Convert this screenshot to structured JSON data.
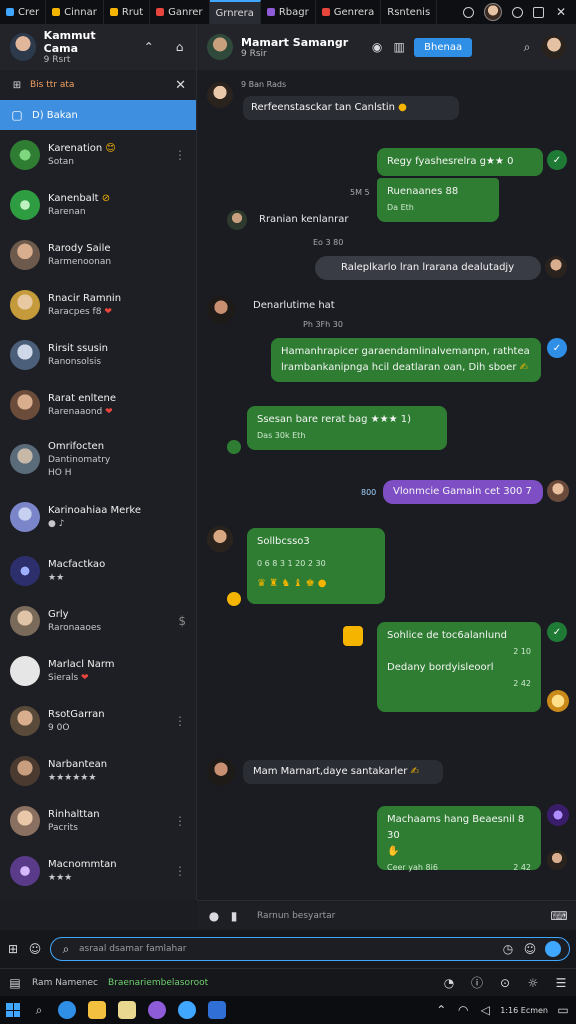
{
  "tabs": [
    {
      "label": "Crer",
      "color": "#3fa7ff"
    },
    {
      "label": "Cinnar",
      "color": "#f4b400"
    },
    {
      "label": "Rrut",
      "color": "#f4b400"
    },
    {
      "label": "Ganrer",
      "color": "#e8453c"
    },
    {
      "label": "Grnrera",
      "color": "#3fa7ff",
      "active": true
    },
    {
      "label": "Rbagr",
      "color": "#8e5cd9"
    },
    {
      "label": "Genrera",
      "color": "#e8453c"
    },
    {
      "label": "Rsntenis",
      "color": "#888888"
    }
  ],
  "sidebar": {
    "profile": {
      "name": "Kammut Cama",
      "sub": "9 Rsrt"
    },
    "search_text": "Bis ttr ata",
    "selected_label": "D) Bakan",
    "items": [
      {
        "name": "Karenation",
        "preview": "Sotan",
        "color": "#2e7d32",
        "badge": "😊"
      },
      {
        "name": "Kanenbalt",
        "preview": "Rarenan",
        "color": "#2e9d42",
        "badge": "⊘"
      },
      {
        "name": "Rarody Saile",
        "preview": "Rarmenoonan",
        "color": "#6d5a4c"
      },
      {
        "name": "Rnacir Ramnin",
        "preview": "Raracpes f8",
        "color": "#c49a3a",
        "badge": "❤"
      },
      {
        "name": "Rirsit ssusin",
        "preview": "Ranonsolsis",
        "color": "#4b5f7a"
      },
      {
        "name": "Rarat enltene",
        "preview": "Rarenaaond",
        "color": "#6b4c3a",
        "badge": "❤"
      },
      {
        "name": "Omrifocten",
        "preview": "Dantinomatry",
        "color": "#5a6b7a",
        "extra": "HO  H"
      },
      {
        "name": "Karinoahiaa Merke",
        "preview": "",
        "color": "#7a86c9"
      },
      {
        "name": "Macfactkao",
        "preview": "★★",
        "color": "#2c2f6b"
      },
      {
        "name": "Grly",
        "preview": "Raronaaoes",
        "color": "#7a6a5a",
        "extra_right": "$"
      },
      {
        "name": "Marlacl Narm",
        "preview": "Sierals",
        "color": "#e6e6e6",
        "badge": "❤"
      },
      {
        "name": "RsotGarran",
        "preview": "9 0O",
        "color": "#5a4a3a"
      },
      {
        "name": "Narbantean",
        "preview": "★★★★★★",
        "color": "#4a3a30"
      },
      {
        "name": "Rinhalttan",
        "preview": "Pacrits",
        "color": "#8a7060"
      },
      {
        "name": "Macnommtan",
        "preview": "★★★",
        "color": "#5a3b8a"
      }
    ]
  },
  "header": {
    "name": "Mamart Samangr",
    "sub": "9 Rsir",
    "button_label": "Bhenaa"
  },
  "messages": {
    "m1": "Rerfeenstasckar tan  Canlstin",
    "m1_meta": "9 Ban Rads",
    "m2": "Regy fyashesrelra g★★ 0",
    "m2_sub": "Ruenaanes 88",
    "m2_meta": "Da Eth",
    "m2_time": "5M 5",
    "m3": "Rranian kenlanrar",
    "m3_time": "Eo 3 80",
    "m4": "Raleplkarlo lran lrarana dealutadjy",
    "m5_name": "Denarlutime hat",
    "m5_time": "Ph 3Fh 30",
    "m6": "Hamanhrapicer garaendamlinalvemanpn, rathtea lrambankanipnga hcil deatlaran oan, Dih sboer",
    "m7": "Ssesan bare rerat bag ★★★ 1)",
    "m7_meta": "Das 30k Eth",
    "m8": "Vlonmcie Gamain cet 300 7",
    "m8_meta": "800",
    "m9": "Sollbcsso3 ... 8 2 1 ...",
    "m9_title": "Sollbcsso3",
    "m9_line": "0 6 8 3 1 20 2 30",
    "m10": "Sohlice de toc6alanlund",
    "m10_sub": "Dedany bordyisleoorl",
    "m10_time1": "2 10",
    "m10_time2": "2 42",
    "m11": "Mam Marnart,daye santakarler",
    "m12": "Machaams hang Beaesnil 8 30",
    "m12_meta": "Ceer yah 8i6",
    "m12_time": "2 42"
  },
  "composer": {
    "top_hint": "Rarnun besyartar",
    "placeholder": "asraal dsamar famlahar"
  },
  "status": {
    "left": "Ram Namenec",
    "green": "Braenariembelasoroot"
  },
  "taskbar": {
    "clock": "1:16 Ecmen"
  }
}
